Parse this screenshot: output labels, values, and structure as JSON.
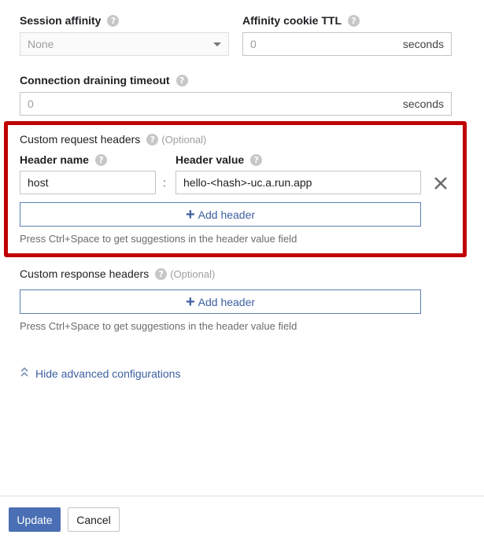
{
  "session_affinity": {
    "label": "Session affinity",
    "value": "None"
  },
  "affinity_cookie_ttl": {
    "label": "Affinity cookie TTL",
    "value": "0",
    "suffix": "seconds"
  },
  "connection_draining": {
    "label": "Connection draining timeout",
    "value": "0",
    "suffix": "seconds"
  },
  "custom_request_headers": {
    "label": "Custom request headers",
    "optional": "(Optional)",
    "header_name_label": "Header name",
    "header_value_label": "Header value",
    "header_name": "host",
    "separator": ":",
    "header_value": "hello-<hash>-uc.a.run.app",
    "add_label": "Add header",
    "hint": "Press Ctrl+Space to get suggestions in the header value field"
  },
  "custom_response_headers": {
    "label": "Custom response headers",
    "optional": "(Optional)",
    "add_label": "Add header",
    "hint": "Press Ctrl+Space to get suggestions in the header value field"
  },
  "advanced": {
    "label": "Hide advanced configurations"
  },
  "footer": {
    "update_label": "Update",
    "cancel_label": "Cancel"
  },
  "icons": {
    "help": "help-icon",
    "remove": "close-icon",
    "add": "plus-icon",
    "collapse": "chevron-up-icon"
  },
  "colors": {
    "highlight": "#c00000",
    "accent": "#4a6fb4",
    "link": "#3c5fa0"
  }
}
